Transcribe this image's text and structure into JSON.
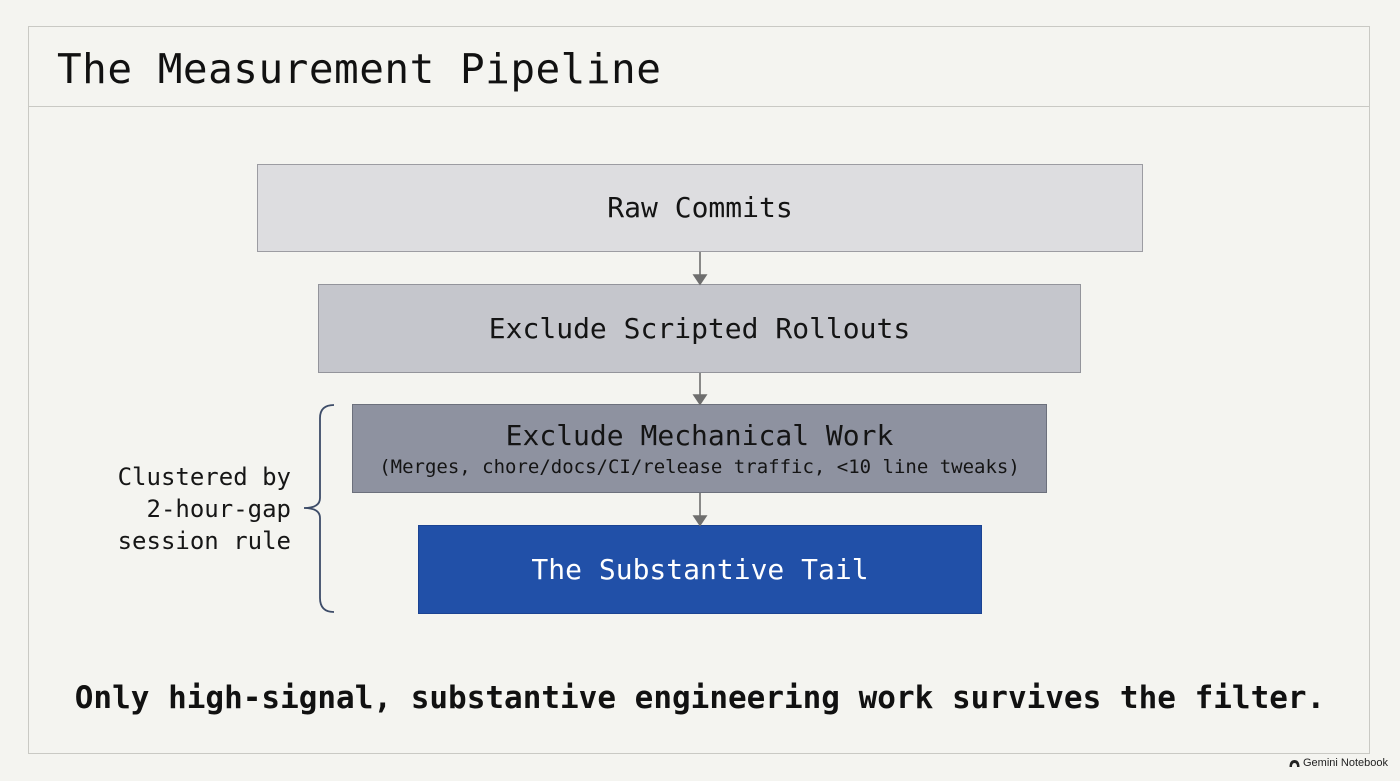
{
  "slide": {
    "title": "The Measurement Pipeline"
  },
  "pipeline": {
    "stages": [
      {
        "label": "Raw Commits",
        "fill": "#dddde0"
      },
      {
        "label": "Exclude Scripted Rollouts",
        "fill": "#c5c6cc"
      },
      {
        "label": "Exclude Mechanical Work",
        "detail": "(Merges, chore/docs/CI/release traffic, <10 line tweaks)",
        "fill": "#8e92a0"
      },
      {
        "label": "The Substantive Tail",
        "fill": "#2150a8",
        "text_color": "#ffffff"
      }
    ],
    "bracket_note": {
      "line1": "Clustered by",
      "line2": "2-hour-gap",
      "line3": "session rule"
    }
  },
  "conclusion": "Only high-signal, substantive engineering work survives the filter.",
  "watermark": {
    "text": "Gemini Notebook",
    "icon": "notebook-logo-icon"
  },
  "colors": {
    "background": "#f4f4f0",
    "frame_border": "#c9c9c4",
    "arrow": "#6e6e6e",
    "accent": "#2150a8"
  }
}
